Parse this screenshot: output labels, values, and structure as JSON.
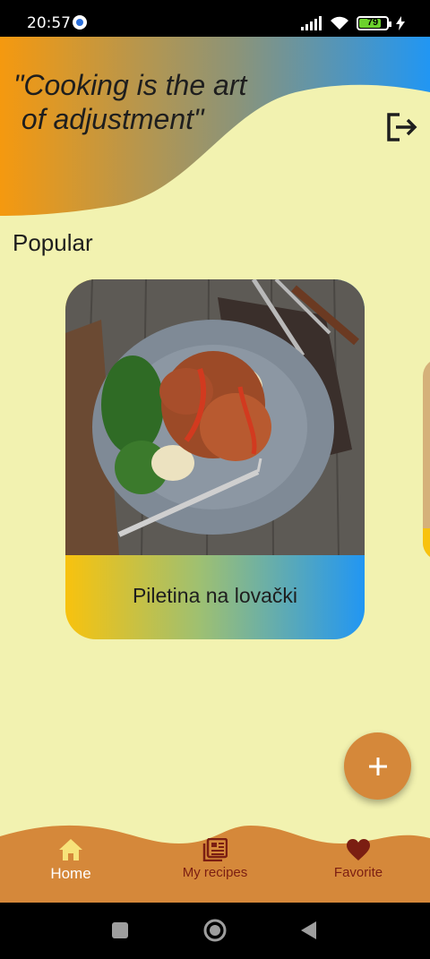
{
  "status_bar": {
    "time": "20:57",
    "battery": "79",
    "battery_level": 0.79
  },
  "header": {
    "quote": "\"Cooking is the art\n of adjustment\""
  },
  "section": {
    "title": "Popular"
  },
  "recipes": [
    {
      "title": "Piletina na lovački"
    }
  ],
  "bottom_nav": {
    "items": [
      {
        "label": "Home",
        "icon": "home-icon",
        "active": true
      },
      {
        "label": "My recipes",
        "icon": "recipes-icon",
        "active": false
      },
      {
        "label": "Favorite",
        "icon": "heart-icon",
        "active": false
      }
    ]
  },
  "colors": {
    "background": "#f2f2b0",
    "header_gradient_start": "#f5990f",
    "header_gradient_end": "#2196f3",
    "fab": "#d5883a",
    "nav_bar": "#d5883a",
    "nav_icon_inactive": "#7b1e12"
  }
}
